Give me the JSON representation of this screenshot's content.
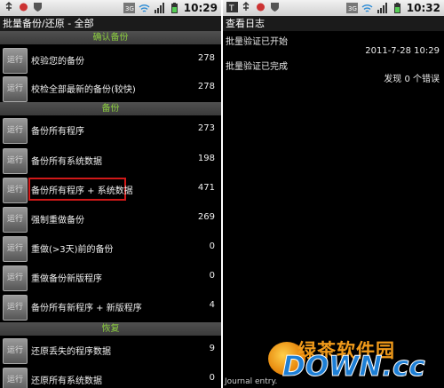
{
  "colors": {
    "section_text": "#8ccf3f",
    "highlight": "#d01818",
    "watermark_orange": "#f09a1a",
    "watermark_blue": "#1d7fd6"
  },
  "left": {
    "status": {
      "time": "10:29",
      "icons": [
        "usb-icon",
        "notification-icon",
        "signal-3g-icon",
        "wifi-icon",
        "network-bars-icon",
        "battery-icon"
      ]
    },
    "title": "批量备份/还原 - 全部",
    "run_label": "运行",
    "sections": {
      "verify": "确认备份",
      "backup": "备份",
      "restore": "恢复"
    },
    "verify_rows": [
      {
        "label": "校验您的备份",
        "count": "278"
      },
      {
        "label": "校检全部最新的备份(较快)",
        "count": "278"
      }
    ],
    "backup_rows": [
      {
        "label": "备份所有程序",
        "count": "273"
      },
      {
        "label": "备份所有系统数据",
        "count": "198"
      },
      {
        "label": "备份所有程序 + 系统数据",
        "count": "471"
      },
      {
        "label": "强制重做备份",
        "count": "269"
      },
      {
        "label": "重做(>3天)前的备份",
        "count": "0"
      },
      {
        "label": "重做备份新版程序",
        "count": "0"
      },
      {
        "label": "备份所有新程序 + 新版程序",
        "count": "4"
      }
    ],
    "restore_rows": [
      {
        "label": "还原丢失的程序数据",
        "count": "9"
      },
      {
        "label": "还原所有系统数据",
        "count": "0"
      }
    ]
  },
  "right": {
    "status": {
      "time": "10:32",
      "icons": [
        "app-icon",
        "usb-icon",
        "notification-icon",
        "signal-3g-icon",
        "wifi-icon",
        "network-bars-icon",
        "battery-icon"
      ]
    },
    "title": "查看日志",
    "log": {
      "line1": "批量验证已开始",
      "timestamp": "2011-7-28 10:29",
      "line2": "批量验证已完成",
      "result": "发现 0 个错误"
    },
    "bottom_text": "Journal entry."
  },
  "watermark": {
    "line1": "绿茶软件园",
    "line2": "DOWN.cc"
  }
}
